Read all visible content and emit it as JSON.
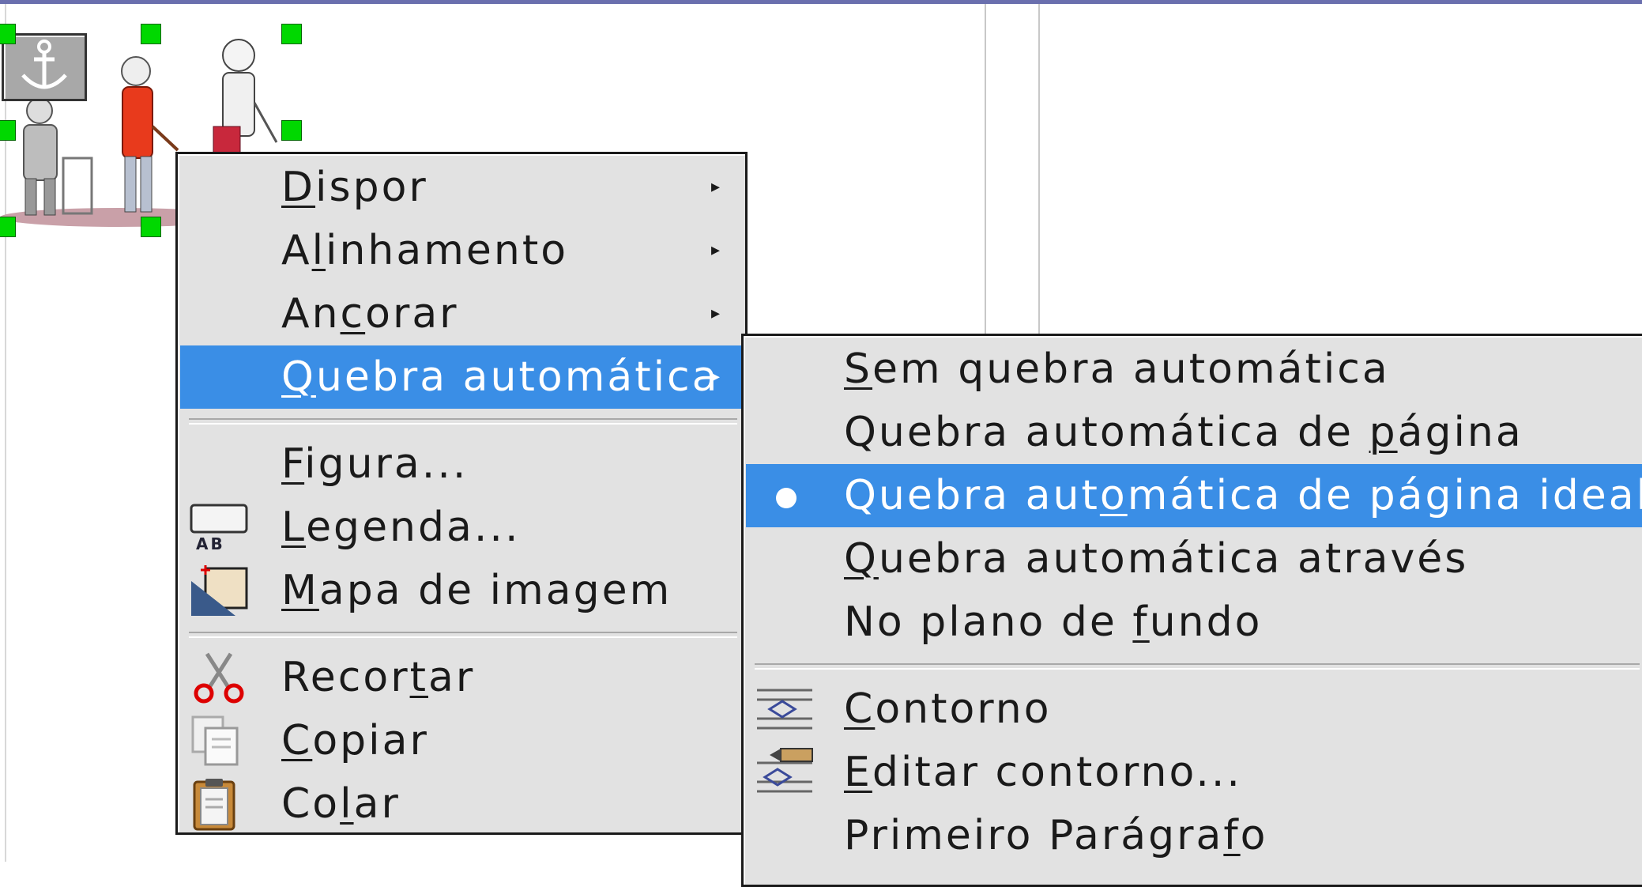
{
  "context_menu": {
    "items": [
      {
        "pre": "",
        "key": "D",
        "post": "ispor",
        "submenu": true
      },
      {
        "pre": "A",
        "key": "l",
        "post": "inhamento",
        "submenu": true
      },
      {
        "pre": "An",
        "key": "c",
        "post": "orar",
        "submenu": true
      },
      {
        "pre": "",
        "key": "Q",
        "post": "uebra automática",
        "submenu": true,
        "highlighted": true
      },
      {
        "pre": "",
        "key": "F",
        "post": "igura...",
        "icon": ""
      },
      {
        "pre": "",
        "key": "L",
        "post": "egenda...",
        "icon": "caption-icon"
      },
      {
        "pre": "",
        "key": "M",
        "post": "apa de imagem",
        "icon": "image-map-icon"
      },
      {
        "pre": "Recor",
        "key": "t",
        "post": "ar",
        "icon": "scissors-icon"
      },
      {
        "pre": "",
        "key": "C",
        "post": "opiar",
        "icon": "copy-icon"
      },
      {
        "pre": "Co",
        "key": "l",
        "post": "ar",
        "icon": "paste-icon"
      }
    ]
  },
  "wrap_submenu": {
    "items": [
      {
        "pre": "",
        "key": "S",
        "post": "em quebra automática"
      },
      {
        "pre": "Quebra automática de ",
        "key": "p",
        "post": "ágina"
      },
      {
        "pre": "Quebra aut",
        "key": "o",
        "post": "mática de página ideal",
        "selected": true
      },
      {
        "pre": "",
        "key": "Q",
        "post": "uebra automática através"
      },
      {
        "pre": "No plano de ",
        "key": "f",
        "post": "undo"
      },
      {
        "pre": "",
        "key": "C",
        "post": "ontorno",
        "icon": "contour-icon"
      },
      {
        "pre": "",
        "key": "E",
        "post": "ditar contorno...",
        "icon": "edit-contour-icon"
      },
      {
        "pre": "Primeiro Parágra",
        "key": "f",
        "post": "o"
      }
    ]
  },
  "colors": {
    "highlight": "#3a8ee6",
    "menu_bg": "#e2e2e2",
    "handle": "#00d800"
  }
}
